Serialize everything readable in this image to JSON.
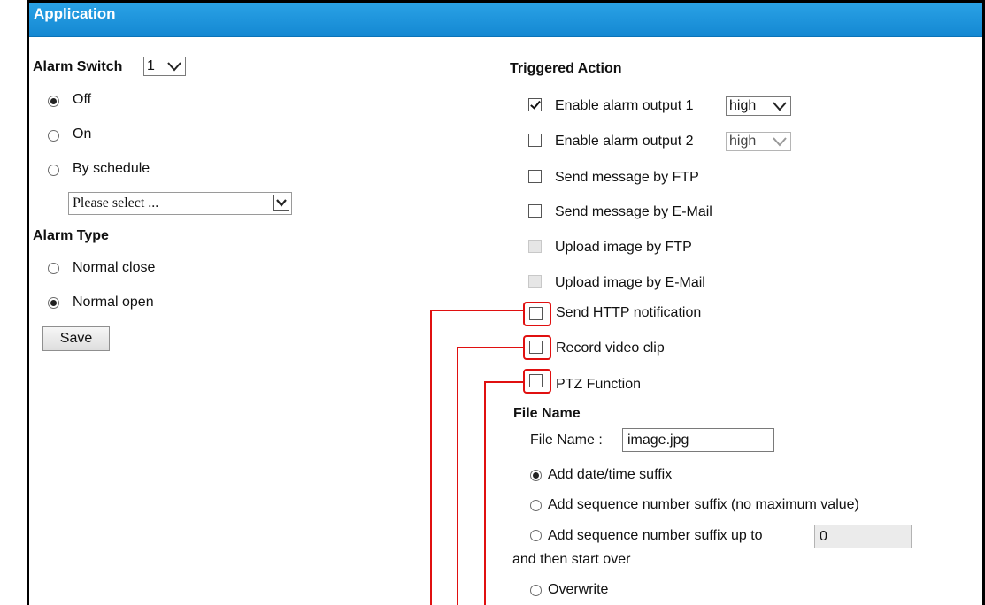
{
  "window": {
    "title": "Application"
  },
  "left": {
    "alarm_switch_label": "Alarm Switch",
    "alarm_switch_value": "1",
    "switch_options": [
      {
        "label": "Off",
        "selected": true
      },
      {
        "label": "On",
        "selected": false
      },
      {
        "label": "By schedule",
        "selected": false
      }
    ],
    "schedule_placeholder": "Please select ...",
    "alarm_type_label": "Alarm Type",
    "alarm_type_options": [
      {
        "label": "Normal close",
        "selected": false
      },
      {
        "label": "Normal open",
        "selected": true
      }
    ],
    "save_label": "Save"
  },
  "right": {
    "triggered_action_label": "Triggered Action",
    "actions": [
      {
        "label": "Enable alarm output 1",
        "checked": true,
        "disabled": false,
        "level": "high"
      },
      {
        "label": "Enable alarm output 2",
        "checked": false,
        "disabled": false,
        "level": "high"
      },
      {
        "label": "Send message by FTP",
        "checked": false,
        "disabled": false
      },
      {
        "label": "Send message by E-Mail",
        "checked": false,
        "disabled": false
      },
      {
        "label": "Upload image by FTP",
        "checked": false,
        "disabled": true
      },
      {
        "label": "Upload image by E-Mail",
        "checked": false,
        "disabled": true
      },
      {
        "label": "Send HTTP notification",
        "checked": false,
        "disabled": false,
        "highlighted": true
      },
      {
        "label": "Record video clip",
        "checked": false,
        "disabled": false,
        "highlighted": true
      },
      {
        "label": "PTZ Function",
        "checked": false,
        "disabled": false,
        "highlighted": true
      }
    ],
    "file_name_section": "File Name",
    "file_name_label": "File Name :",
    "file_name_value": "image.jpg",
    "suffix_options": [
      {
        "label": "Add date/time suffix",
        "selected": true
      },
      {
        "label": "Add sequence number suffix (no maximum value)",
        "selected": false
      },
      {
        "label": "Add sequence number suffix up to",
        "selected": false
      },
      {
        "label": "Overwrite",
        "selected": false
      }
    ],
    "sequence_max_value": "0",
    "start_over_text": "and then start over"
  },
  "colors": {
    "title_bar": "#1a8fd8",
    "highlight": "#e01010"
  }
}
